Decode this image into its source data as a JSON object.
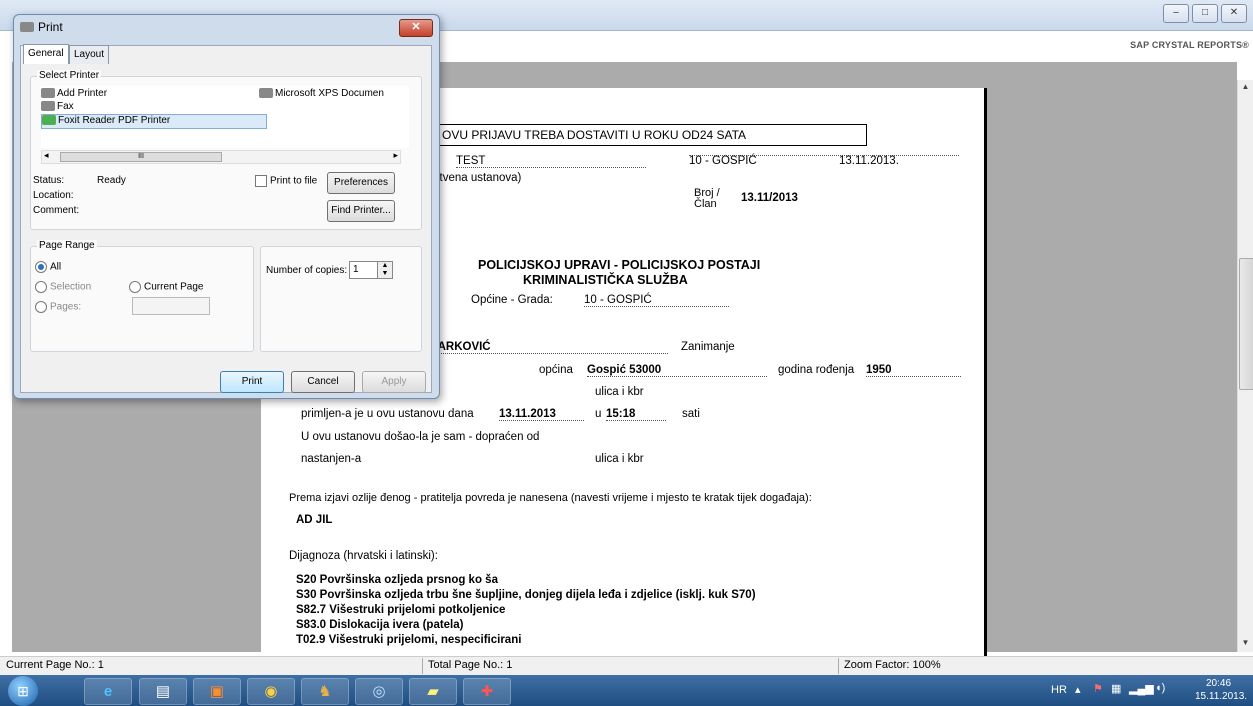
{
  "window": {
    "minimize": "–",
    "maximize": "□",
    "close": "✕",
    "brand": "SAP CRYSTAL REPORTS®"
  },
  "report": {
    "box_title": "OVU PRIJAVU TREBA DOSTAVITI U ROKU OD24 SATA",
    "test": "TEST",
    "city_top": "10 - GOSPIĆ",
    "date_top": "13.11.2013.",
    "ustanova": "ystvena ustanova)",
    "broj_label": "Broj /",
    "clan_label": "Član",
    "broj_value": "13.11/2013",
    "heading1": "POLICIJSKOJ UPRAVI - POLICIJSKOJ POSTAJI",
    "heading2": "KRIMINALISTIČKA SLUŽBA",
    "opcina_grada_label": "Općine - Grada:",
    "opcina_grada_value": "10 - GOSPIĆ",
    "surname": "MARKOVIĆ",
    "zanimanje": "Zanimanje",
    "opcina_label": "općina",
    "opcina_value": "Gospić 53000",
    "godina_label": "godina rođenja",
    "godina_value": "1950",
    "ulica1": "ulica i kbr",
    "primljen_label": "primljen-a je u ovu ustanovu dana",
    "primljen_date": "13.11.2013",
    "u_label": "u",
    "time_value": "15:18",
    "sati_label": "sati",
    "dosao": "U ovu ustanovu došao-la je sam - dopraćen od",
    "nastanjen": "nastanjen-a",
    "ulica2": "ulica i kbr",
    "izjava": "Prema izjavi ozlije đenog - pratitelja povreda je nanesena (navesti vrijeme i mjesto te kratak tijek događaja):",
    "izjava_value": "AD JIL",
    "dijagnoza_label": "Dijagnoza (hrvatski i latinski):",
    "diagnoses": [
      "S20 Površinska ozljeda prsnog ko ša",
      "S30 Površinska ozljeda trbu šne šupljine, donjeg dijela leđa i zdjelice (isklj. kuk S70)",
      "S82.7 Višestruki prijelomi potkoljenice",
      "S83.0 Dislokacija ivera (patela)",
      "T02.9 Višestruki prijelomi, nespecificirani"
    ]
  },
  "status": {
    "current_page": "Current Page No.: 1",
    "total_page": "Total Page No.: 1",
    "zoom": "Zoom Factor: 100%"
  },
  "dialog": {
    "title": "Print",
    "close": "✕",
    "tabs": [
      "General",
      "Layout"
    ],
    "select_printer": "Select Printer",
    "printers": [
      "Add Printer",
      "Microsoft XPS Documen",
      "Fax",
      "Foxit Reader PDF Printer"
    ],
    "scroll_mid": "III",
    "status_label": "Status:",
    "status_value": "Ready",
    "location_label": "Location:",
    "comment_label": "Comment:",
    "print_to_file": "Print to file",
    "preferences": "Preferences",
    "find_printer": "Find Printer...",
    "page_range": "Page Range",
    "all": "All",
    "selection": "Selection",
    "current_page": "Current Page",
    "pages": "Pages:",
    "copies_label": "Number of copies:",
    "copies_value": "1",
    "print": "Print",
    "cancel": "Cancel",
    "apply": "Apply"
  },
  "taskbar": {
    "icons": [
      "windows-start-icon",
      "internet-explorer-icon",
      "file-explorer-icon",
      "media-player-icon",
      "chrome-icon",
      "game-icon",
      "network-icon",
      "notes-icon",
      "ambulance-app-icon"
    ],
    "lang": "HR",
    "time": "20:46",
    "date": "15.11.2013."
  }
}
